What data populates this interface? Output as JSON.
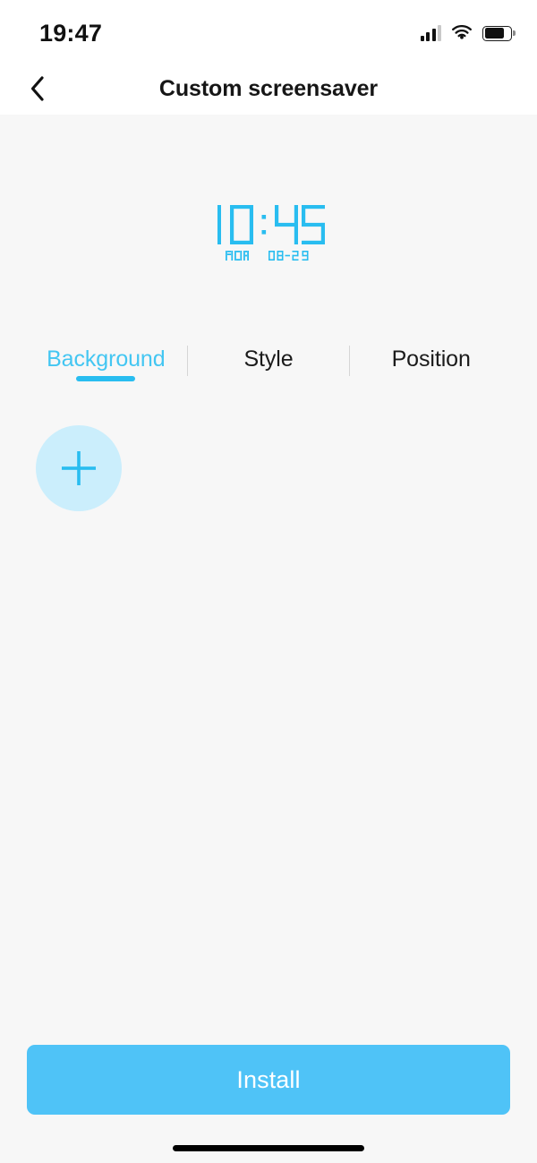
{
  "status_bar": {
    "time": "19:47",
    "signal_icon": "signal-bars-icon",
    "wifi_icon": "wifi-icon",
    "battery_icon": "battery-icon",
    "signal_bars_filled": 3,
    "signal_bars_total": 4,
    "battery_level_percent": 76
  },
  "nav": {
    "back_icon": "chevron-left-icon",
    "title": "Custom screensaver"
  },
  "preview": {
    "clock_time": "10:45",
    "clock_hour": "10",
    "clock_minute": "45",
    "weekday": "MON",
    "date": "08-29",
    "clock_color": "#29bdf0"
  },
  "tabs": [
    {
      "label": "Background",
      "active": true
    },
    {
      "label": "Style",
      "active": false
    },
    {
      "label": "Position",
      "active": false
    }
  ],
  "picker": {
    "add_icon": "plus-icon",
    "add_tile_fill": "#cbeefc",
    "add_icon_color": "#29bdf0"
  },
  "footer": {
    "install_label": "Install",
    "install_color": "#4fc3f7"
  },
  "colors": {
    "accent": "#29bdf0",
    "page_background": "#f7f7f7",
    "header_background": "#ffffff",
    "text_primary": "#161616"
  }
}
